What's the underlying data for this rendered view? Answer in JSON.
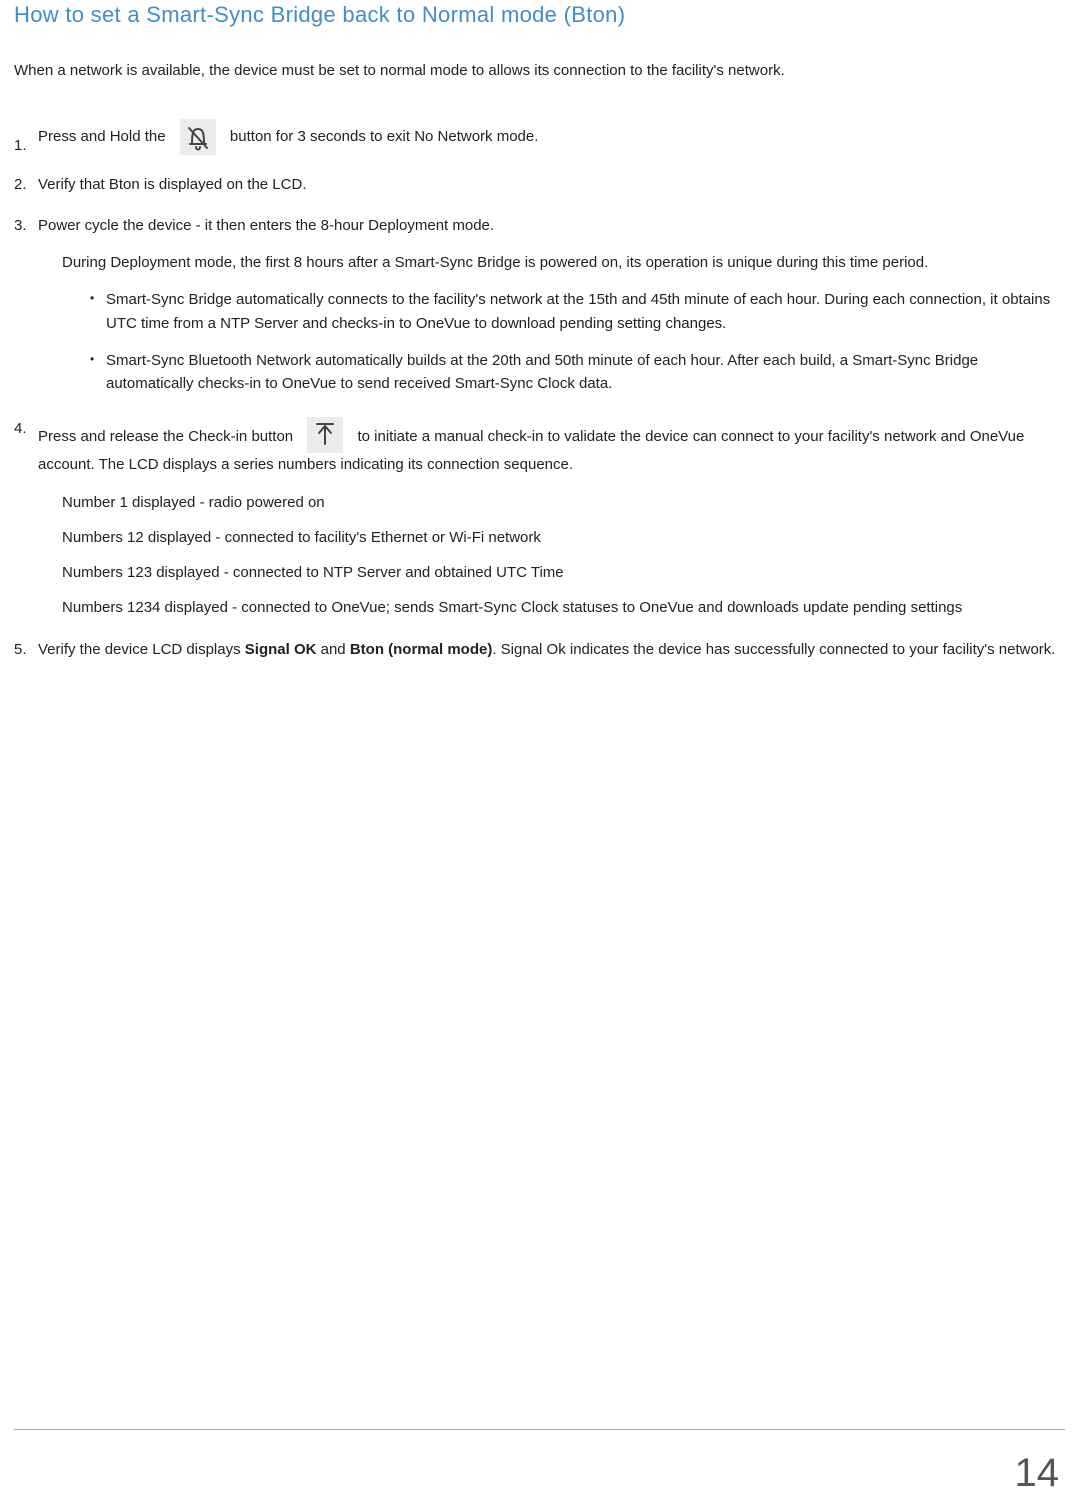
{
  "heading": "How to set a Smart-Sync Bridge back to Normal mode (Bton)",
  "intro": "When a network is available, the device must be set to normal mode to allows its connection to the facility's network.",
  "step1": {
    "pre": "Press and Hold the",
    "post": "button for 3 seconds to exit No Network mode."
  },
  "step2": "Verify that Bton is displayed on the LCD.",
  "step3": "Power cycle the device - it then enters the 8-hour Deployment mode.",
  "step3_sub": "During Deployment mode, the first 8 hours after a Smart-Sync Bridge is powered on, its operation is unique during this time period.",
  "step3_bullets": [
    "Smart-Sync Bridge automatically connects to the facility's network at the 15th and 45th minute of each hour. During each connection, it obtains UTC time from a NTP Server and checks-in to OneVue to download pending setting changes.",
    "Smart-Sync Bluetooth Network automatically builds at the 20th and 50th minute of each hour. After each build, a Smart-Sync Bridge automatically checks-in to OneVue to send received Smart-Sync Clock data."
  ],
  "step4": {
    "pre": "Press and release the Check-in button",
    "post": "to initiate a manual check-in to validate the device can connect to your facility's network and OneVue account. The LCD displays a series numbers indicating its connection sequence."
  },
  "step4_rows": [
    "Number 1 displayed - radio powered on",
    "Numbers 12 displayed - connected to facility's Ethernet or Wi-Fi network",
    "Numbers 123 displayed - connected to NTP Server and obtained UTC Time",
    "Numbers 1234 displayed - connected to OneVue; sends Smart-Sync Clock statuses to OneVue and downloads update pending settings"
  ],
  "step5": {
    "pre": "Verify the device LCD displays ",
    "bold1": "Signal OK",
    "mid": " and ",
    "bold2": "Bton (normal mode)",
    "post": ". Signal Ok indicates the device has successfully connected to your facility's network."
  },
  "pageNumber": "14",
  "icons": {
    "bell": "bell-slash-icon",
    "arrow": "upload-arrow-icon"
  }
}
